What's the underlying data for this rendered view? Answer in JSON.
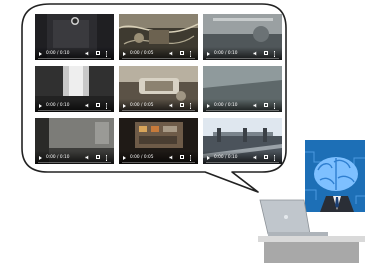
{
  "videos": [
    {
      "time": "0:00 / 0:10",
      "scene": "dark-interior",
      "colors": [
        "#1f1f22",
        "#3a3a3e"
      ]
    },
    {
      "time": "0:00 / 0:05",
      "scene": "machinery-cables",
      "colors": [
        "#8a8270",
        "#3e3a30"
      ]
    },
    {
      "time": "0:00 / 0:10",
      "scene": "grey-surface",
      "colors": [
        "#9aa0a2",
        "#50575a"
      ]
    },
    {
      "time": "0:00 / 0:10",
      "scene": "bright-window",
      "colors": [
        "#c8c8c8",
        "#303030"
      ]
    },
    {
      "time": "0:00 / 0:05",
      "scene": "metal-part",
      "colors": [
        "#b8b0a0",
        "#5b5246"
      ]
    },
    {
      "time": "0:00 / 0:10",
      "scene": "wall-closeup",
      "colors": [
        "#8f9a9c",
        "#4a5456"
      ]
    },
    {
      "time": "0:00 / 0:10",
      "scene": "grey-wall",
      "colors": [
        "#7c7c78",
        "#3c3c3a"
      ]
    },
    {
      "time": "0:00 / 0:05",
      "scene": "control-panel",
      "colors": [
        "#6e5b48",
        "#1f1a16"
      ]
    },
    {
      "time": "0:00 / 0:10",
      "scene": "outdoor-rail",
      "colors": [
        "#dfe7ef",
        "#4b535b"
      ]
    }
  ],
  "colors": {
    "bubble_stroke": "#222222",
    "brain_panel": "#1d6fb6",
    "brain": "#7ec0ff",
    "desk": "#c9c9c9",
    "laptop": "#c0c6cc"
  },
  "icons": [
    "brain-icon",
    "laptop-icon",
    "play-icon",
    "volume-icon",
    "fullscreen-icon",
    "more-icon"
  ]
}
